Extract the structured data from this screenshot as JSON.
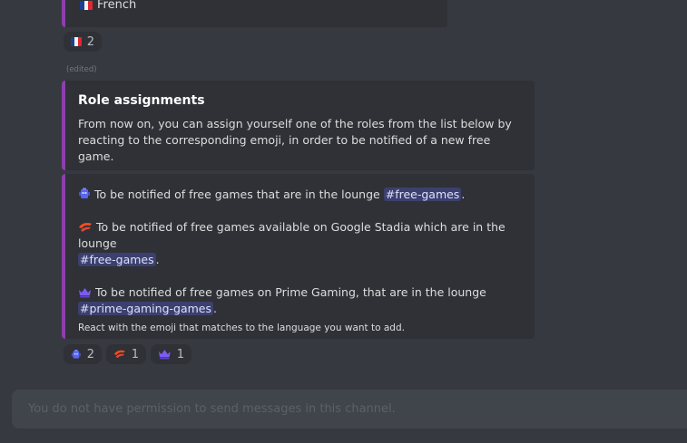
{
  "top_embed": {
    "language": "French"
  },
  "top_reaction": {
    "emoji": "french-flag",
    "count": "2"
  },
  "edited_label": "(edited)",
  "role_embed": {
    "title": "Role assignments",
    "description": "From now on, you can assign yourself one of the roles from the list below by reacting to the corresponding emoji, in order to be notified of a new free game."
  },
  "options_embed": {
    "lines": [
      {
        "emoji": "robot-emoji",
        "text": "To be notified of free games that are in the lounge",
        "channel": "#free-games",
        "suffix": "."
      },
      {
        "emoji": "stadia-emoji",
        "text": "To be notified of free games available on Google Stadia which are in the lounge",
        "channel": "#free-games",
        "suffix": "."
      },
      {
        "emoji": "crown-emoji",
        "text": "To be notified of free games on Prime Gaming, that are in the lounge",
        "channel": "#prime-gaming-games",
        "suffix": "."
      }
    ],
    "footer": "React with the emoji that matches to the language you want to add."
  },
  "reactions": [
    {
      "emoji": "robot-emoji",
      "count": "2"
    },
    {
      "emoji": "stadia-emoji",
      "count": "1"
    },
    {
      "emoji": "crown-emoji",
      "count": "1"
    }
  ],
  "message_input": {
    "placeholder": "You do not have permission to send messages in this channel."
  },
  "colors": {
    "background": "#36393f",
    "embed_background": "#2f3136",
    "embed_accent": "#8c3fae",
    "mention": "#5865f2",
    "robot": "#5865f2",
    "stadia": "#e2453a",
    "crown": "#7b5cf0"
  }
}
